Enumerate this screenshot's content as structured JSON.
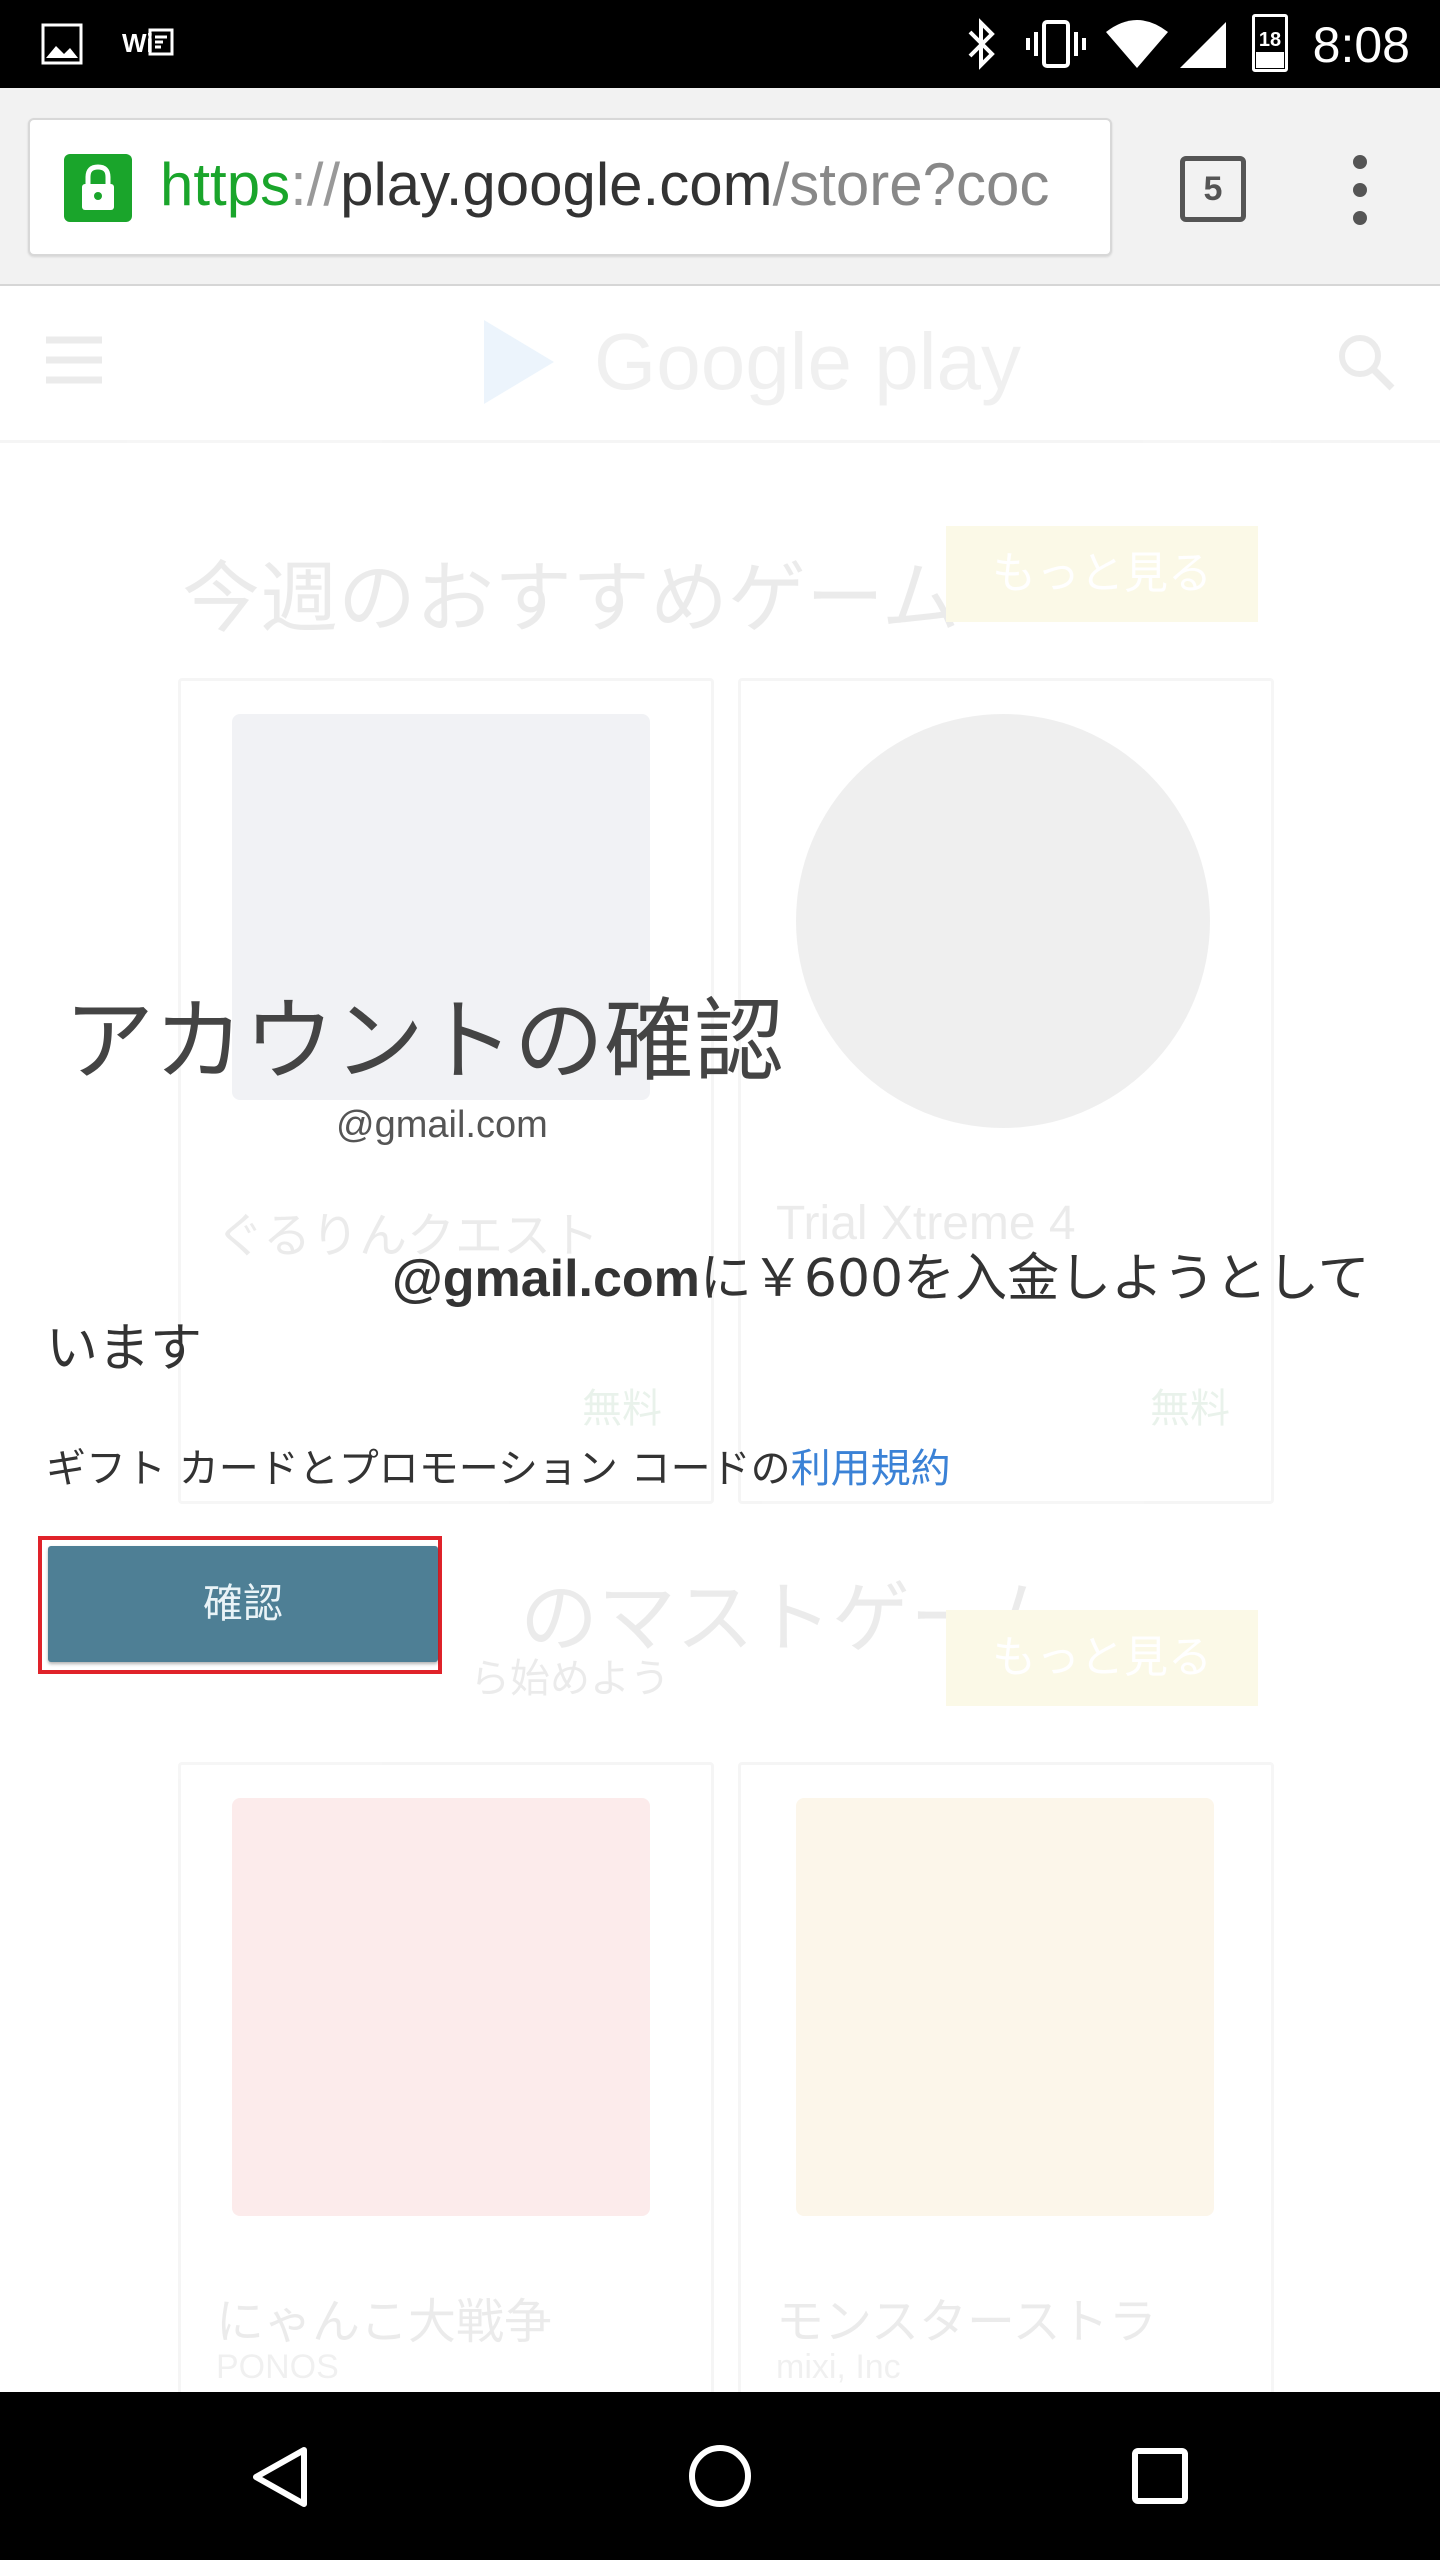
{
  "status_bar": {
    "time": "8:08",
    "wifi_label": "Wi",
    "battery_level": "18"
  },
  "browser": {
    "url_scheme": "https",
    "url_separator": "://",
    "url_host": "play.google.com",
    "url_path": "/store?coc",
    "tab_count": "5"
  },
  "background_page": {
    "logo_text": "Google play",
    "section1_title": "今週のおすすめゲーム",
    "section1_more": "もっと見る",
    "app1_name": "ぐるりんクエスト",
    "app1_price": "無料",
    "app2_name": "Trial Xtreme 4",
    "app2_price": "無料",
    "section2_title": "のマストゲーム",
    "section2_subtitle": "ら始めよう",
    "section2_more": "もっと見る",
    "app3_name": "にゃんこ大戦争",
    "app3_developer": "PONOS",
    "app4_name": "モンスターストラ",
    "app4_developer": "mixi, Inc"
  },
  "dialog": {
    "title": "アカウントの確認",
    "account_email": "@gmail.com",
    "message_email": "@gmail.com",
    "message_part1": "に￥600を入金しようとして",
    "message_part2": "います",
    "terms_prefix": "ギフト カードとプロモーション コードの",
    "terms_link": "利用規約",
    "confirm_label": "確認"
  },
  "colors": {
    "confirm_button": "#4e7f95",
    "highlight_border": "#e0222a",
    "link": "#3b82d6",
    "secure_green": "#1aa52b"
  }
}
